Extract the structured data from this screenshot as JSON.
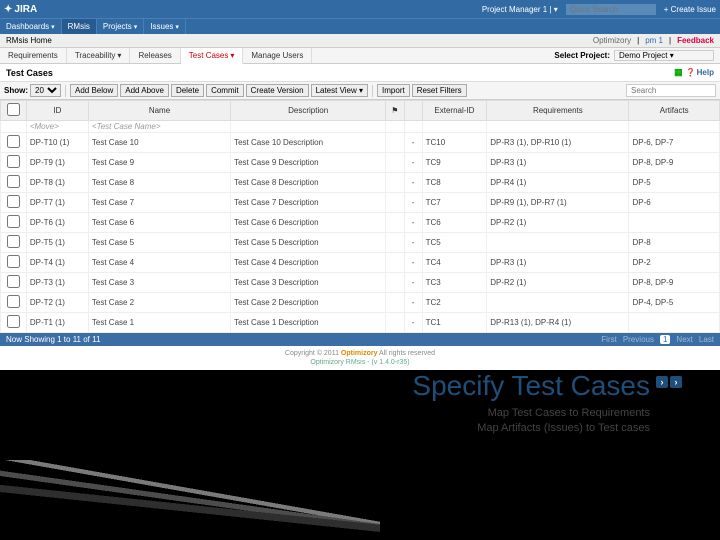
{
  "header": {
    "logo": "JIRA",
    "user": "Project Manager 1",
    "search_placeholder": "Quick Search",
    "create_issue": "+ Create Issue"
  },
  "nav": {
    "dashboards": "Dashboards",
    "rmsis": "RMsis",
    "projects": "Projects",
    "issues": "Issues"
  },
  "rmsis_home": {
    "label": "RMsis Home",
    "optimizory": "Optimizory",
    "pm1": "pm 1",
    "feedback": "Feedback"
  },
  "subnav": {
    "requirements": "Requirements",
    "traceability": "Traceability",
    "releases": "Releases",
    "testcases": "Test Cases",
    "manage_users": "Manage Users",
    "select_project_label": "Select Project:",
    "project": "Demo Project"
  },
  "page": {
    "title": "Test Cases",
    "help": "Help"
  },
  "toolbar": {
    "show_label": "Show:",
    "show_value": "20",
    "add_below": "Add Below",
    "add_above": "Add Above",
    "delete": "Delete",
    "commit": "Commit",
    "create_version": "Create Version",
    "latest_view": "Latest View",
    "import": "Import",
    "reset_filters": "Reset Filters",
    "search_placeholder": "Search"
  },
  "columns": {
    "id": "ID",
    "name": "Name",
    "desc": "Description",
    "ext": "External-ID",
    "req": "Requirements",
    "art": "Artifacts"
  },
  "filter_row": {
    "id": "<Move>",
    "name": "<Test Case Name>"
  },
  "rows": [
    {
      "id": "DP-T10 (1)",
      "name": "Test Case 10",
      "desc": "Test Case 10 Description",
      "ext": "TC10",
      "req": "DP-R3 (1), DP-R10 (1)",
      "art": "DP-6, DP-7"
    },
    {
      "id": "DP-T9 (1)",
      "name": "Test Case 9",
      "desc": "Test Case 9 Description",
      "ext": "TC9",
      "req": "DP-R3 (1)",
      "art": "DP-8, DP-9"
    },
    {
      "id": "DP-T8 (1)",
      "name": "Test Case 8",
      "desc": "Test Case 8 Description",
      "ext": "TC8",
      "req": "DP-R4 (1)",
      "art": "DP-5"
    },
    {
      "id": "DP-T7 (1)",
      "name": "Test Case 7",
      "desc": "Test Case 7 Description",
      "ext": "TC7",
      "req": "DP-R9 (1), DP-R7 (1)",
      "art": "DP-6"
    },
    {
      "id": "DP-T6 (1)",
      "name": "Test Case 6",
      "desc": "Test Case 6 Description",
      "ext": "TC6",
      "req": "DP-R2 (1)",
      "art": ""
    },
    {
      "id": "DP-T5 (1)",
      "name": "Test Case 5",
      "desc": "Test Case 5 Description",
      "ext": "TC5",
      "req": "",
      "art": "DP-8"
    },
    {
      "id": "DP-T4 (1)",
      "name": "Test Case 4",
      "desc": "Test Case 4 Description",
      "ext": "TC4",
      "req": "DP-R3 (1)",
      "art": "DP-2"
    },
    {
      "id": "DP-T3 (1)",
      "name": "Test Case 3",
      "desc": "Test Case 3 Description",
      "ext": "TC3",
      "req": "DP-R2 (1)",
      "art": "DP-8, DP-9"
    },
    {
      "id": "DP-T2 (1)",
      "name": "Test Case 2",
      "desc": "Test Case 2 Description",
      "ext": "TC2",
      "req": "",
      "art": "DP-4, DP-5"
    },
    {
      "id": "DP-T1 (1)",
      "name": "Test Case 1",
      "desc": "Test Case 1 Description",
      "ext": "TC1",
      "req": "DP-R13 (1), DP-R4 (1)",
      "art": ""
    }
  ],
  "pager": {
    "showing": "Now Showing 1 to 11 of 11",
    "first": "First",
    "prev": "Previous",
    "page": "1",
    "next": "Next",
    "last": "Last"
  },
  "footer": {
    "copyright": "Copyright © 2011 ",
    "brand": "Optimizory",
    "rights": " All rights reserved",
    "version": "Optimizory RMsis - (v 1.4.0-r35)"
  },
  "slide": {
    "title": "Specify Test Cases",
    "sub1": "Map Test Cases to Requirements",
    "sub2": "Map Artifacts (Issues) to Test cases"
  }
}
